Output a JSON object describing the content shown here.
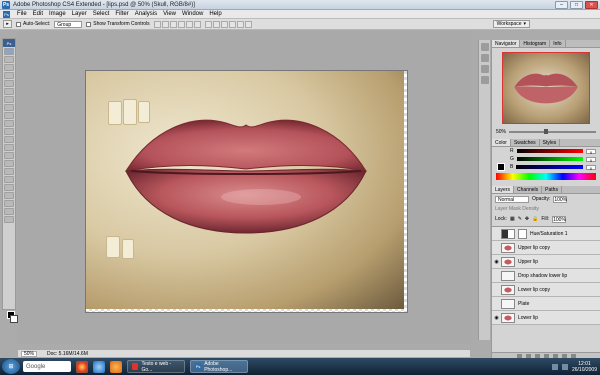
{
  "window": {
    "title": "Adobe Photoshop CS4 Extended - [lips.psd @ 50% (Skull, RGB/8#)]",
    "controls": [
      "–",
      "□",
      "✕"
    ]
  },
  "menubar": {
    "items": [
      "File",
      "Edit",
      "Image",
      "Layer",
      "Select",
      "Filter",
      "Analysis",
      "View",
      "Window",
      "Help"
    ],
    "workspace_label": "Workspace"
  },
  "options": {
    "auto_select_label": "Auto-Select:",
    "auto_select_value": "Group",
    "show_transform_label": "Show Transform Controls"
  },
  "status": {
    "zoom": "50%",
    "doc_size": "Doc: 5.16M/14.6M"
  },
  "navigator": {
    "tabs": [
      "Navigator",
      "Histogram",
      "Info"
    ],
    "zoom": "50%"
  },
  "color_panel": {
    "tabs": [
      "Color",
      "Swatches",
      "Styles"
    ],
    "channels": [
      {
        "label": "R",
        "value": "0"
      },
      {
        "label": "G",
        "value": "0"
      },
      {
        "label": "B",
        "value": "0"
      }
    ]
  },
  "layers_panel": {
    "tabs": [
      "Layers",
      "Channels",
      "Paths"
    ],
    "blend_mode": "Normal",
    "opacity_label": "Opacity:",
    "opacity": "100%",
    "fill_label": "Fill:",
    "fill": "100%",
    "lock_label": "Lock:",
    "mask_density": "Layer Mask Density",
    "layers": [
      {
        "name": "Hue/Saturation 1",
        "visible": false,
        "thumb": "adj",
        "mask": true,
        "selected": false
      },
      {
        "name": "Upper lip copy",
        "visible": false,
        "thumb": "lip",
        "mask": false,
        "selected": false
      },
      {
        "name": "Upper lip",
        "visible": true,
        "thumb": "lip",
        "mask": false,
        "selected": false
      },
      {
        "name": "Drop shadow lower lip",
        "visible": false,
        "thumb": "plain",
        "mask": false,
        "selected": false
      },
      {
        "name": "Lower lip copy",
        "visible": false,
        "thumb": "lip",
        "mask": false,
        "selected": false
      },
      {
        "name": "Plate",
        "visible": false,
        "thumb": "plain",
        "mask": false,
        "selected": false
      },
      {
        "name": "Lower lip",
        "visible": true,
        "thumb": "lip",
        "mask": false,
        "selected": false
      }
    ]
  },
  "taskbar": {
    "search_label": "Google",
    "tasks": [
      {
        "label": "Testo e web - Go...",
        "active": false
      },
      {
        "label": "Adobe Photoshop...",
        "active": true
      }
    ],
    "time": "12:01",
    "date": "26/10/2009"
  },
  "colors": {
    "accent": "#2a6cb0",
    "lip": "#b4525a",
    "selected_layer": "#9bb4d6"
  }
}
